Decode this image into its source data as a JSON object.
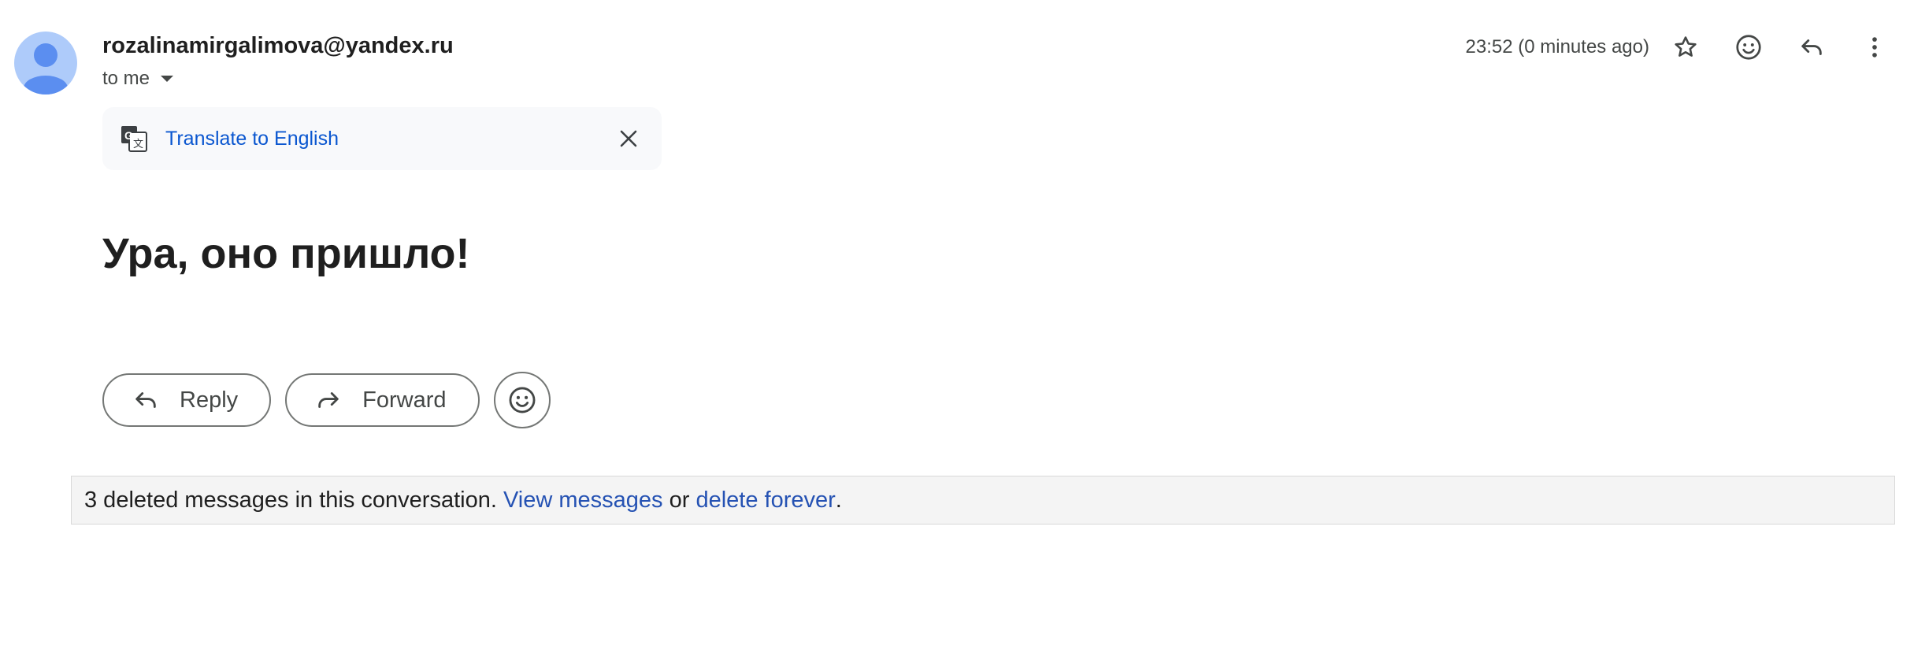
{
  "header": {
    "sender": "rozalinamirgalimova@yandex.ru",
    "recipients_label": "to me",
    "timestamp": "23:52 (0 minutes ago)",
    "icons": [
      "star-icon",
      "emoji-icon",
      "reply-icon",
      "more-vert-icon"
    ]
  },
  "translate_bar": {
    "link_label": "Translate to English",
    "icon": "translate-icon",
    "close_icon": "close-icon"
  },
  "message": {
    "body": "Ура, оно пришло!"
  },
  "actions": {
    "reply_label": "Reply",
    "forward_label": "Forward",
    "emoji_icon": "add-reaction-icon"
  },
  "deleted_notice": {
    "text": "3 deleted messages in this conversation.",
    "view_link": "View messages",
    "connector": "or",
    "delete_link": "delete forever",
    "end": "."
  },
  "colors": {
    "link": "#0b57d0",
    "avatar_bg": "#aecbfa",
    "avatar_fg": "#5b8ef0",
    "notice_bg": "#f4f4f4"
  }
}
